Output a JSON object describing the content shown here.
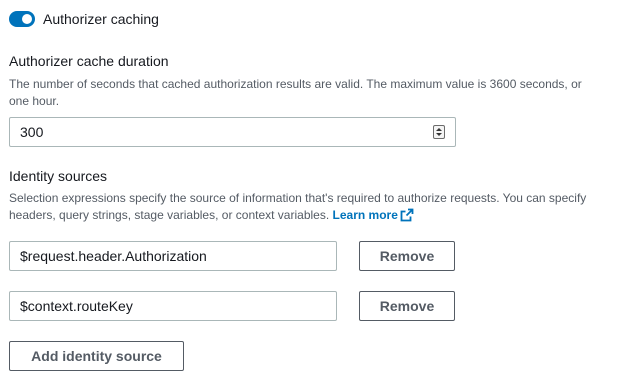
{
  "caching": {
    "toggle_label": "Authorizer caching",
    "enabled": true
  },
  "cache_duration": {
    "label": "Authorizer cache duration",
    "description": "The number of seconds that cached authorization results are valid. The maximum value is 3600 seconds, or one hour.",
    "value": "300"
  },
  "identity_sources": {
    "label": "Identity sources",
    "description": "Selection expressions specify the source of information that's required to authorize requests. You can specify headers, query strings, stage variables, or context variables.",
    "learn_more": "Learn more",
    "items": [
      {
        "value": "$request.header.Authorization",
        "remove_label": "Remove"
      },
      {
        "value": "$context.routeKey",
        "remove_label": "Remove"
      }
    ],
    "add_label": "Add identity source"
  },
  "colors": {
    "accent": "#0073bb",
    "text": "#16191f",
    "secondary_text": "#545b64",
    "border": "#aab7b8"
  },
  "icons": {
    "external_link": "external-link-icon",
    "stepper": "number-stepper-icon"
  }
}
